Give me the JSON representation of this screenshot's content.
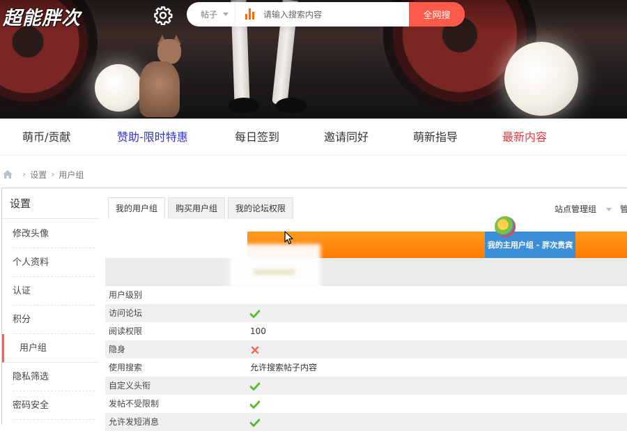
{
  "header": {
    "logo_text": "超能胖次",
    "search": {
      "scope": "帖子",
      "placeholder": "请输入搜索内容",
      "submit_label": "全网搜"
    }
  },
  "nav": {
    "items": [
      {
        "label": "萌币/贡献",
        "color": "#333333"
      },
      {
        "label": "赞助-限时特惠",
        "color": "#3333cc"
      },
      {
        "label": "每日签到",
        "color": "#333333"
      },
      {
        "label": "邀请同好",
        "color": "#333333"
      },
      {
        "label": "萌新指导",
        "color": "#333333"
      },
      {
        "label": "最新内容",
        "color": "#e4393c"
      }
    ]
  },
  "breadcrumb": {
    "items": [
      "设置",
      "用户组"
    ]
  },
  "sidebar": {
    "title": "设置",
    "items": [
      {
        "label": "修改头像"
      },
      {
        "label": "个人资料"
      },
      {
        "label": "认证"
      },
      {
        "label": "积分"
      },
      {
        "label": "用户组",
        "active": true
      },
      {
        "label": "隐私筛选"
      },
      {
        "label": "密码安全"
      }
    ]
  },
  "tabs": [
    {
      "label": "我的用户组",
      "active": true
    },
    {
      "label": "购买用户组"
    },
    {
      "label": "我的论坛权限"
    }
  ],
  "moderation": {
    "label": "站点管理组",
    "more": "管"
  },
  "group_header": {
    "label": "我的主用户组 - 胖次贵宾"
  },
  "permissions": [
    {
      "name": "用户级别",
      "value": "",
      "icon": ""
    },
    {
      "name": "访问论坛",
      "value": "",
      "icon": "check-icon"
    },
    {
      "name": "阅读权限",
      "value": "100",
      "icon": ""
    },
    {
      "name": "隐身",
      "value": "",
      "icon": "cross-icon"
    },
    {
      "name": "使用搜索",
      "value": "允许搜索帖子内容",
      "icon": ""
    },
    {
      "name": "自定义头衔",
      "value": "",
      "icon": "check-icon"
    },
    {
      "name": "发帖不受限制",
      "value": "",
      "icon": "check-icon"
    },
    {
      "name": "允许发短消息",
      "value": "",
      "icon": "check-icon"
    }
  ],
  "colors": {
    "accent": "#fd5a4a",
    "orange_band": "#ff8a00",
    "blue_band": "#3b8fd9",
    "check": "#5cb82e",
    "cross": "#f06a5f"
  }
}
